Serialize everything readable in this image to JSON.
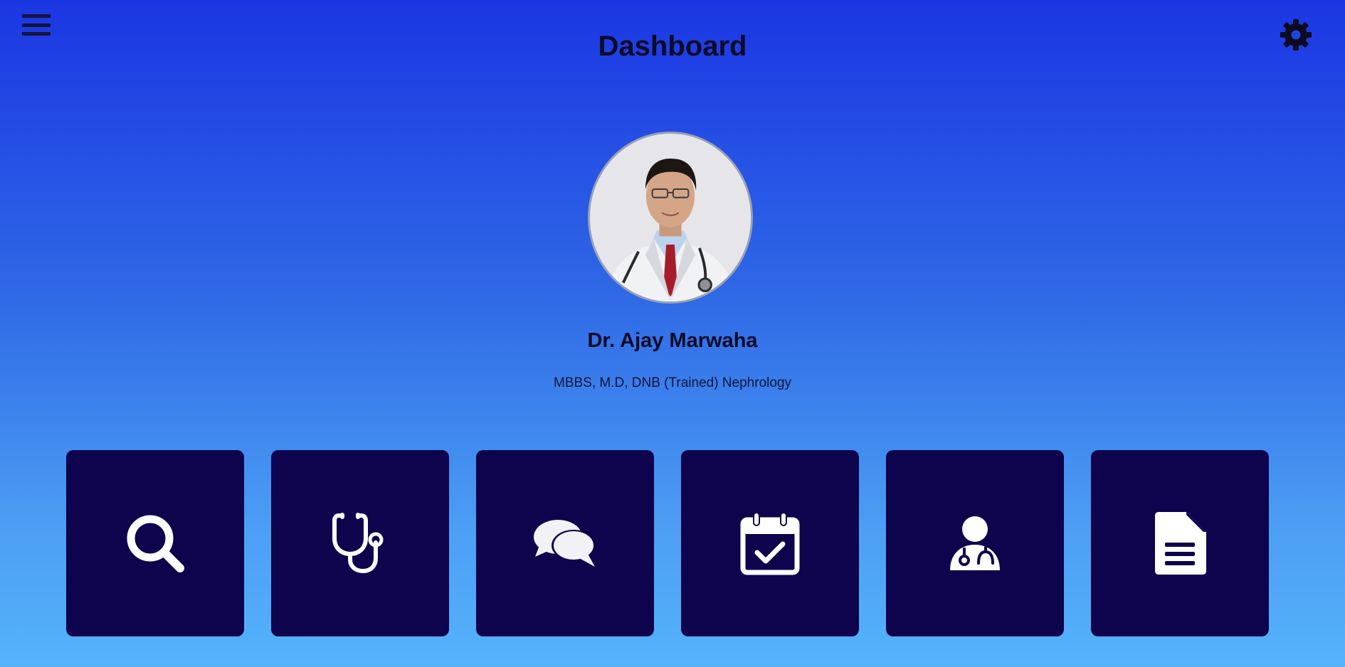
{
  "header": {
    "title": "Dashboard",
    "menu_icon": "hamburger-menu-icon",
    "settings_icon": "gear-icon"
  },
  "profile": {
    "name": "Dr. Ajay Marwaha",
    "qualification": "MBBS, M.D, DNB (Trained) Nephrology",
    "avatar": "doctor-portrait-photo"
  },
  "tiles": [
    {
      "icon": "search-icon"
    },
    {
      "icon": "stethoscope-icon"
    },
    {
      "icon": "chat-bubbles-icon"
    },
    {
      "icon": "calendar-check-icon"
    },
    {
      "icon": "doctor-icon"
    },
    {
      "icon": "document-icon"
    }
  ],
  "colors": {
    "background_top": "#1b36e3",
    "background_bottom": "#55b3fb",
    "tile_bg": "#0e034d",
    "tile_icon": "#ffffff",
    "text": "#0c0b26"
  }
}
